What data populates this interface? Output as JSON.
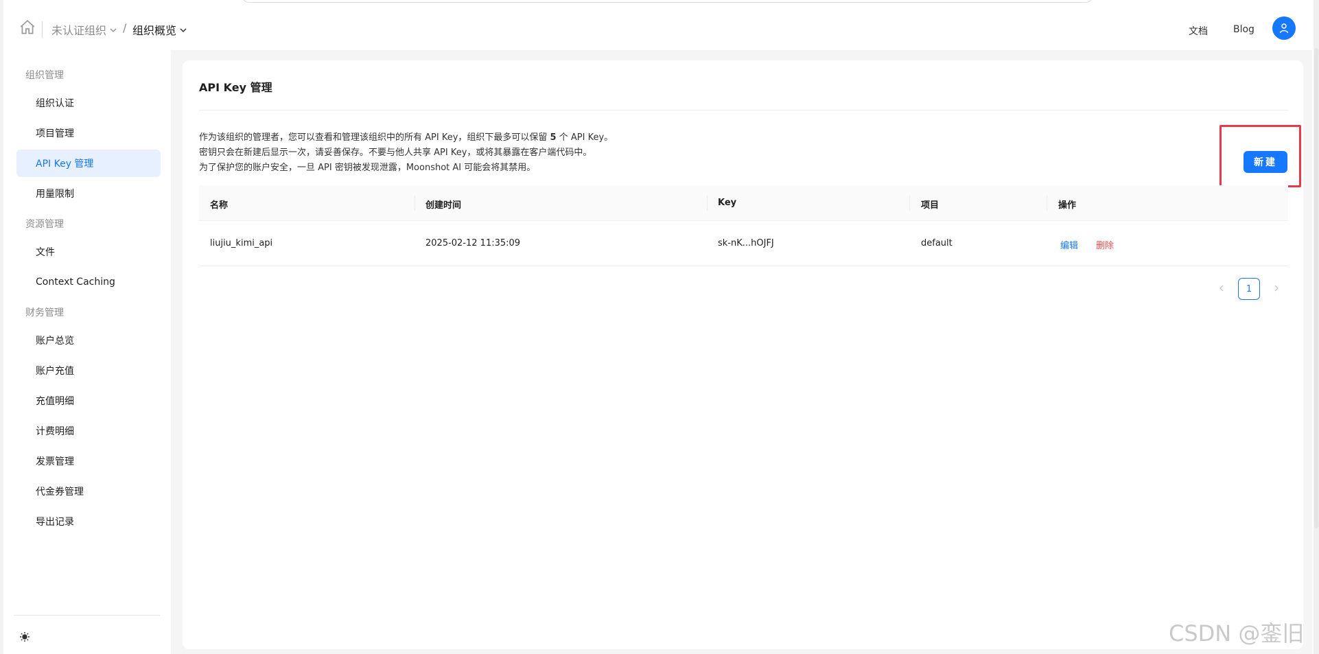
{
  "header": {
    "breadcrumb": {
      "org": "未认证组织",
      "separator": "/",
      "page": "组织概览"
    },
    "nav": {
      "docs": "文档",
      "blog": "Blog"
    }
  },
  "sidebar": {
    "groups": [
      {
        "title": "组织管理",
        "items": [
          "组织认证",
          "项目管理",
          "API Key 管理",
          "用量限制"
        ]
      },
      {
        "title": "资源管理",
        "items": [
          "文件",
          "Context Caching"
        ]
      },
      {
        "title": "财务管理",
        "items": [
          "账户总览",
          "账户充值",
          "充值明细",
          "计费明细",
          "发票管理",
          "代金券管理",
          "导出记录"
        ]
      }
    ],
    "active_item": "API Key 管理"
  },
  "main": {
    "title": "API Key 管理",
    "description": {
      "line1_prefix": "作为该组织的管理者，您可以查看和管理该组织中的所有 API Key，组织下最多可以保留",
      "line1_count": "5",
      "line1_suffix": "个 API Key。",
      "line2": "密钥只会在新建后显示一次，请妥善保存。不要与他人共享 API Key，或将其暴露在客户端代码中。",
      "line3": "为了保护您的账户安全，一旦 API 密钥被发现泄露，Moonshot AI 可能会将其禁用。"
    },
    "new_button": "新建",
    "table": {
      "columns": [
        "名称",
        "创建时间",
        "Key",
        "项目",
        "操作"
      ],
      "rows": [
        {
          "name": "liujiu_kimi_api",
          "created": "2025-02-12 11:35:09",
          "key": "sk-nK...hOJFJ",
          "project": "default",
          "edit": "编辑",
          "delete": "删除"
        }
      ]
    },
    "pagination": {
      "current": "1"
    }
  },
  "watermark": "CSDN @銮旧",
  "colors": {
    "accent": "#1677ff",
    "danger": "#ff4d4f",
    "highlight": "#e8394a"
  }
}
